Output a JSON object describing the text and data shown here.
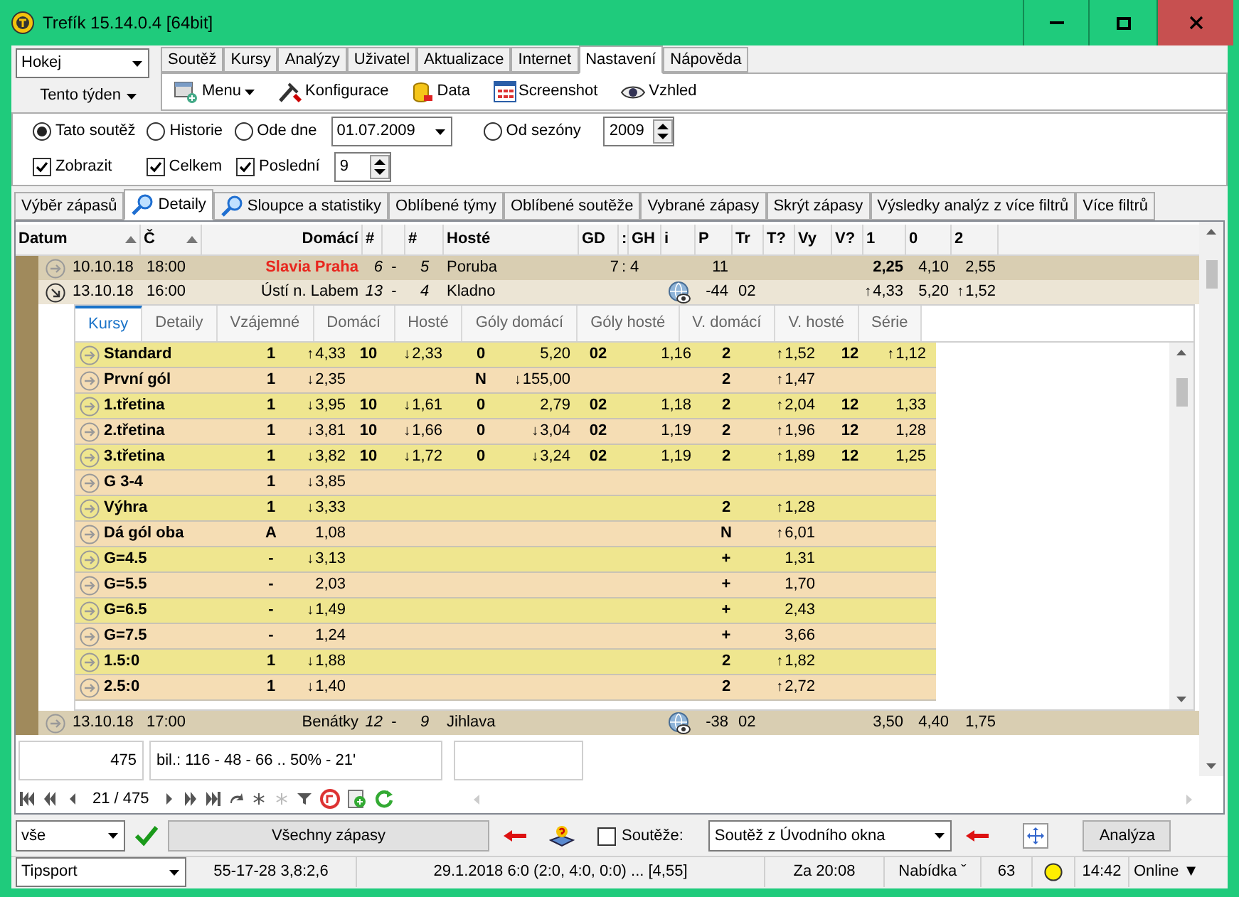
{
  "window": {
    "title": "Trefík 15.14.0.4 [64bit]"
  },
  "sport_select": {
    "value": "Hokej"
  },
  "period_button": {
    "label": "Tento týden"
  },
  "menu_tabs": [
    {
      "label": "Soutěž",
      "selected": false
    },
    {
      "label": "Kursy",
      "selected": false
    },
    {
      "label": "Analýzy",
      "selected": false
    },
    {
      "label": "Uživatel",
      "selected": false
    },
    {
      "label": "Aktualizace",
      "selected": false
    },
    {
      "label": "Internet",
      "selected": false
    },
    {
      "label": "Nastavení",
      "selected": true
    },
    {
      "label": "Nápověda",
      "selected": false
    }
  ],
  "toolbar": [
    {
      "label": "Menu",
      "kind": "menu"
    },
    {
      "label": "Konfigurace",
      "kind": "tools"
    },
    {
      "label": "Data",
      "kind": "data"
    },
    {
      "label": "Screenshot",
      "kind": "screenshot"
    },
    {
      "label": "Vzhled",
      "kind": "view"
    }
  ],
  "filters": {
    "scope": [
      {
        "label": "Tato soutěž",
        "selected": true
      },
      {
        "label": "Historie",
        "selected": false
      },
      {
        "label": "Ode dne",
        "selected": false
      },
      {
        "label": "Od sezóny",
        "selected": false
      }
    ],
    "date": "01.07.2009",
    "season": "2009",
    "checks": [
      {
        "label": "Zobrazit",
        "checked": true
      },
      {
        "label": "Celkem",
        "checked": true
      },
      {
        "label": "Poslední",
        "checked": true
      }
    ],
    "last_count": "9"
  },
  "view_tabs": [
    {
      "label": "Výběr zápasů",
      "selected": false,
      "icon": false
    },
    {
      "label": "Detaily",
      "selected": true,
      "icon": true
    },
    {
      "label": "Sloupce a statistiky",
      "selected": false,
      "icon": true
    },
    {
      "label": "Oblíbené týmy",
      "selected": false,
      "icon": false
    },
    {
      "label": "Oblíbené soutěže",
      "selected": false,
      "icon": false
    },
    {
      "label": "Vybrané zápasy",
      "selected": false,
      "icon": false
    },
    {
      "label": "Skrýt zápasy",
      "selected": false,
      "icon": false
    },
    {
      "label": "Výsledky analýz z více filtrů",
      "selected": false,
      "icon": false
    },
    {
      "label": "Více filtrů",
      "selected": false,
      "icon": false
    }
  ],
  "matches": {
    "columns": [
      {
        "label": "Datum",
        "sorted": true
      },
      {
        "label": "Č",
        "sorted": true
      },
      {
        "label": "Domácí",
        "sorted": false
      },
      {
        "label": "#",
        "sorted": false
      },
      {
        "label": "#",
        "sorted": false
      },
      {
        "label": "Hosté",
        "sorted": false
      },
      {
        "label": "GD",
        "sorted": false
      },
      {
        "label": ":",
        "sorted": false
      },
      {
        "label": "GH",
        "sorted": false
      },
      {
        "label": "i",
        "sorted": false
      },
      {
        "label": "P",
        "sorted": false
      },
      {
        "label": "Tr",
        "sorted": false
      },
      {
        "label": "T?",
        "sorted": false
      },
      {
        "label": "Vy",
        "sorted": false
      },
      {
        "label": "V?",
        "sorted": false
      },
      {
        "label": "1",
        "sorted": false
      },
      {
        "label": "0",
        "sorted": false
      },
      {
        "label": "2",
        "sorted": false
      }
    ],
    "rows": [
      {
        "date": "10.10.18",
        "time": "18:00",
        "home": "Slavia Praha",
        "home_highlight": true,
        "home_score": "6",
        "score_sep": "-",
        "away_score": "5",
        "away": "Poruba",
        "gd": "7",
        "gd_sep": ":",
        "gh": "4",
        "info_icon": false,
        "points": "11",
        "expanded": false,
        "odds": [
          {
            "value": "2,25",
            "bold": true
          },
          {
            "value": "4,10",
            "bold": false
          },
          {
            "value": "2,55",
            "bold": false
          }
        ]
      },
      {
        "date": "13.10.18",
        "time": "16:00",
        "home": "Ústí n. Labem",
        "home_highlight": false,
        "home_score": "13",
        "score_sep": "-",
        "away_score": "4",
        "away": "Kladno",
        "info_icon": true,
        "points": "-44",
        "tr": "02",
        "expanded": true,
        "odds": [
          {
            "value": "4,33",
            "bold": false,
            "trend": "↑"
          },
          {
            "value": "5,20",
            "bold": false
          },
          {
            "value": "1,52",
            "bold": false,
            "trend": "↑"
          }
        ],
        "detail": {
          "tabs": [
            {
              "label": "Kursy",
              "selected": true
            },
            {
              "label": "Detaily",
              "selected": false
            },
            {
              "label": "Vzájemné",
              "selected": false
            },
            {
              "label": "Domácí",
              "selected": false
            },
            {
              "label": "Hosté",
              "selected": false
            },
            {
              "label": "Góly domácí",
              "selected": false
            },
            {
              "label": "Góly hosté",
              "selected": false
            },
            {
              "label": "V. domácí",
              "selected": false
            },
            {
              "label": "V. hosté",
              "selected": false
            },
            {
              "label": "Série",
              "selected": false
            }
          ],
          "rows": [
            {
              "name": "Standard",
              "cells": [
                "1",
                {
                  "value": "4,33",
                  "trend": "↑"
                },
                "10",
                {
                  "value": "2,33",
                  "trend": "↓"
                },
                "0",
                {
                  "value": "5,20"
                },
                "02",
                {
                  "value": "1,16"
                },
                "2",
                {
                  "value": "1,52",
                  "trend": "↑"
                },
                "12",
                {
                  "value": "1,12",
                  "trend": "↑"
                }
              ]
            },
            {
              "name": "První gól",
              "cells": [
                "1",
                {
                  "value": "2,35",
                  "trend": "↓"
                },
                null,
                null,
                "N",
                {
                  "value": "155,00",
                  "trend": "↓"
                },
                null,
                null,
                "2",
                {
                  "value": "1,47",
                  "trend": "↑"
                },
                null,
                null
              ]
            },
            {
              "name": "1.třetina",
              "cells": [
                "1",
                {
                  "value": "3,95",
                  "trend": "↓"
                },
                "10",
                {
                  "value": "1,61",
                  "trend": "↓"
                },
                "0",
                {
                  "value": "2,79"
                },
                "02",
                {
                  "value": "1,18"
                },
                "2",
                {
                  "value": "2,04",
                  "trend": "↑"
                },
                "12",
                {
                  "value": "1,33"
                }
              ]
            },
            {
              "name": "2.třetina",
              "cells": [
                "1",
                {
                  "value": "3,81",
                  "trend": "↓"
                },
                "10",
                {
                  "value": "1,66",
                  "trend": "↓"
                },
                "0",
                {
                  "value": "3,04",
                  "trend": "↓"
                },
                "02",
                {
                  "value": "1,19"
                },
                "2",
                {
                  "value": "1,96",
                  "trend": "↑"
                },
                "12",
                {
                  "value": "1,28"
                }
              ]
            },
            {
              "name": "3.třetina",
              "cells": [
                "1",
                {
                  "value": "3,82",
                  "trend": "↓"
                },
                "10",
                {
                  "value": "1,72",
                  "trend": "↓"
                },
                "0",
                {
                  "value": "3,24",
                  "trend": "↓"
                },
                "02",
                {
                  "value": "1,19"
                },
                "2",
                {
                  "value": "1,89",
                  "trend": "↑"
                },
                "12",
                {
                  "value": "1,25"
                }
              ]
            },
            {
              "name": "G 3-4",
              "cells": [
                "1",
                {
                  "value": "3,85",
                  "trend": "↓"
                },
                null,
                null,
                null,
                null,
                null,
                null,
                null,
                null,
                null,
                null
              ]
            },
            {
              "name": "Výhra",
              "cells": [
                "1",
                {
                  "value": "3,33",
                  "trend": "↓"
                },
                null,
                null,
                null,
                null,
                null,
                null,
                "2",
                {
                  "value": "1,28",
                  "trend": "↑"
                },
                null,
                null
              ]
            },
            {
              "name": "Dá gól oba",
              "cells": [
                "A",
                {
                  "value": "1,08"
                },
                null,
                null,
                null,
                null,
                null,
                null,
                "N",
                {
                  "value": "6,01",
                  "trend": "↑"
                },
                null,
                null
              ]
            },
            {
              "name": "G=4.5",
              "cells": [
                "-",
                {
                  "value": "3,13",
                  "trend": "↓"
                },
                null,
                null,
                null,
                null,
                null,
                null,
                "+",
                {
                  "value": "1,31"
                },
                null,
                null
              ]
            },
            {
              "name": "G=5.5",
              "cells": [
                "-",
                {
                  "value": "2,03"
                },
                null,
                null,
                null,
                null,
                null,
                null,
                "+",
                {
                  "value": "1,70"
                },
                null,
                null
              ]
            },
            {
              "name": "G=6.5",
              "cells": [
                "-",
                {
                  "value": "1,49",
                  "trend": "↓"
                },
                null,
                null,
                null,
                null,
                null,
                null,
                "+",
                {
                  "value": "2,43"
                },
                null,
                null
              ]
            },
            {
              "name": "G=7.5",
              "cells": [
                "-",
                {
                  "value": "1,24"
                },
                null,
                null,
                null,
                null,
                null,
                null,
                "+",
                {
                  "value": "3,66"
                },
                null,
                null
              ]
            },
            {
              "name": "1.5:0",
              "cells": [
                "1",
                {
                  "value": "1,88",
                  "trend": "↓"
                },
                null,
                null,
                null,
                null,
                null,
                null,
                "2",
                {
                  "value": "1,82",
                  "trend": "↑"
                },
                null,
                null
              ]
            },
            {
              "name": "2.5:0",
              "cells": [
                "1",
                {
                  "value": "1,40",
                  "trend": "↓"
                },
                null,
                null,
                null,
                null,
                null,
                null,
                "2",
                {
                  "value": "2,72",
                  "trend": "↑"
                },
                null,
                null
              ]
            }
          ]
        }
      },
      {
        "date": "13.10.18",
        "time": "17:00",
        "home": "Benátky",
        "home_highlight": false,
        "home_score": "12",
        "score_sep": "-",
        "away_score": "9",
        "away": "Jihlava",
        "info_icon": true,
        "points": "-38",
        "tr": "02",
        "expanded": false,
        "odds": [
          {
            "value": "3,50",
            "bold": false
          },
          {
            "value": "4,40",
            "bold": false
          },
          {
            "value": "1,75",
            "bold": false
          }
        ]
      }
    ]
  },
  "summary": {
    "count": "475",
    "balance": "bil.: 116 - 48 - 66 .. 50% - 21'"
  },
  "navigator": {
    "position": "21 / 475"
  },
  "action_bar": {
    "filter_select": "vše",
    "all_button": "Všechny zápasy",
    "competitions": {
      "label": "Soutěže:",
      "checked": false
    },
    "competition_select": "Soutěž z Úvodního okna",
    "analyze_button": "Analýza"
  },
  "status_bar": {
    "bookmaker": "Tipsport",
    "stats": "55-17-28  3,8:2,6",
    "last_match": "29.1.2018 6:0 (2:0, 4:0, 0:0) ... [4,55]",
    "countdown": "Za 20:08",
    "offer": "Nabídka ˇ",
    "count": "63",
    "time": "14:42",
    "connection": "Online ▼"
  }
}
